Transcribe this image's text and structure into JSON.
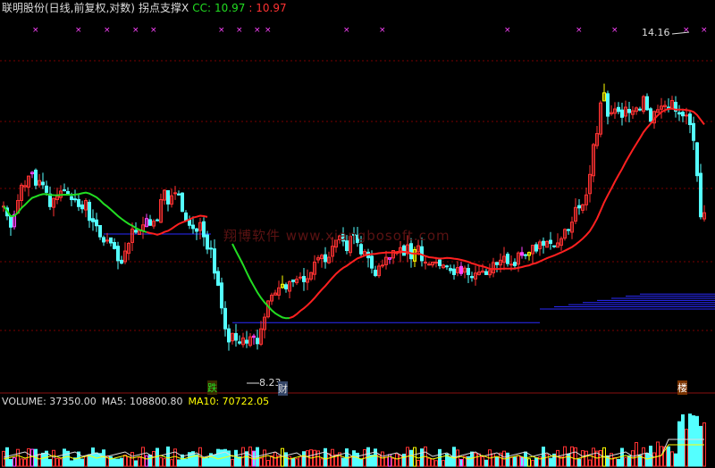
{
  "header": {
    "title": "联明股份(日线,前复权,对数)",
    "indicator": "拐点支撑X",
    "cc_label": "CC:",
    "cc_value": "10.97",
    "cc_value2": ": 10.97"
  },
  "volume_header": {
    "volume": "VOLUME: 37350.00",
    "ma5": "MA5: 108800.80",
    "ma10": "MA10: 70722.05"
  },
  "watermark": "翔博软件 www.xiangbosoft.com",
  "markers": {
    "high_label": "14.16",
    "low_label": "8.23",
    "tag_die": "跌",
    "tag_cai": "财",
    "tag_lou": "楼"
  },
  "colors": {
    "up": "#ff3232",
    "down": "#54ffff",
    "magenta": "#ff44ff",
    "yellow": "#ffff00",
    "ma_green": "#22dd22",
    "ma_red": "#ff2020",
    "support": "#2a2aff",
    "grid": "#7a0000",
    "header_text": "#dcdcdc",
    "cc_label": "#22dd22",
    "cc_value": "#ff3232"
  },
  "chart_data": {
    "type": "candlestick",
    "scale": "log",
    "price_range": [
      7.6,
      16.5
    ],
    "x": [
      1,
      2,
      3,
      4,
      5,
      6,
      7,
      8,
      9,
      10,
      11,
      12,
      13,
      14,
      15,
      16,
      17,
      18,
      19,
      20,
      21,
      22,
      23,
      24,
      25,
      26,
      27,
      28,
      29,
      30,
      31,
      32,
      33,
      34,
      35,
      36,
      37,
      38,
      39,
      40,
      41,
      42,
      43,
      44,
      45,
      46,
      47,
      48,
      49,
      50,
      51,
      52,
      53,
      54,
      55,
      56,
      57,
      58,
      59,
      60,
      61,
      62,
      63,
      64,
      65,
      66,
      67,
      68,
      69,
      70,
      71,
      72,
      73,
      74,
      75,
      76,
      77,
      78,
      79,
      80,
      81,
      82,
      83,
      84,
      85,
      86,
      87,
      88,
      89,
      90,
      91,
      92,
      93,
      94,
      95,
      96,
      97,
      98,
      99,
      100,
      101,
      102,
      103,
      104,
      105,
      106,
      107,
      108,
      109,
      110,
      111,
      112,
      113,
      114,
      115,
      116,
      117,
      118,
      119,
      120,
      121,
      122,
      123,
      124,
      125,
      126,
      127,
      128,
      129,
      130,
      131,
      132,
      133,
      134,
      135,
      136,
      137,
      138,
      139,
      140,
      141,
      142,
      143,
      144,
      145,
      146,
      147,
      148,
      149,
      150,
      151,
      152,
      153,
      154,
      155,
      156,
      157,
      158,
      159,
      160,
      161,
      162,
      163,
      164,
      165,
      166,
      167,
      168,
      169,
      170,
      171,
      172,
      173,
      174,
      175,
      176,
      177,
      178,
      179,
      180,
      181,
      182,
      183,
      184,
      185,
      186,
      187,
      188,
      189,
      190,
      191,
      192,
      193,
      194,
      195,
      196,
      197
    ],
    "close": [
      11.12,
      10.9,
      10.65,
      10.93,
      11.25,
      11.61,
      11.6,
      11.83,
      11.92,
      11.61,
      11.72,
      11.62,
      11.44,
      11.11,
      11.3,
      11.35,
      11.47,
      11.49,
      11.39,
      11.27,
      11.28,
      11.11,
      11.06,
      11.25,
      10.8,
      10.77,
      10.68,
      10.44,
      10.33,
      10.37,
      10.31,
      10.19,
      9.94,
      9.89,
      10.14,
      10.3,
      10.61,
      10.54,
      10.57,
      10.7,
      10.84,
      10.69,
      10.78,
      10.81,
      11.27,
      11.49,
      11.17,
      11.36,
      11.43,
      11.38,
      11.0,
      10.8,
      10.69,
      10.62,
      10.56,
      10.75,
      10.44,
      10.18,
      10.18,
      9.69,
      9.45,
      9.02,
      8.64,
      8.41,
      8.56,
      8.44,
      8.39,
      8.48,
      8.39,
      8.5,
      8.49,
      8.38,
      8.64,
      8.85,
      9.15,
      9.26,
      9.3,
      9.4,
      9.47,
      9.38,
      9.52,
      9.52,
      9.57,
      9.61,
      9.52,
      9.58,
      9.7,
      9.91,
      10.0,
      10.05,
      9.92,
      10.01,
      10.24,
      10.37,
      10.46,
      10.35,
      10.15,
      10.45,
      10.48,
      10.32,
      10.08,
      10.13,
      10.0,
      9.79,
      9.64,
      9.83,
      9.85,
      10.01,
      10.0,
      10.15,
      10.11,
      10.21,
      10.05,
      10.27,
      9.98,
      10.17,
      10.25,
      9.94,
      9.91,
      9.87,
      9.91,
      9.91,
      9.84,
      9.85,
      9.82,
      9.74,
      9.66,
      9.8,
      9.68,
      9.79,
      9.66,
      9.6,
      9.69,
      9.71,
      9.73,
      9.66,
      9.74,
      9.9,
      9.86,
      9.95,
      10.03,
      9.88,
      9.87,
      9.84,
      10.1,
      10.05,
      10.06,
      10.11,
      10.26,
      10.14,
      10.33,
      10.26,
      10.34,
      10.3,
      10.24,
      10.31,
      10.4,
      10.6,
      10.59,
      10.76,
      11.09,
      11.08,
      11.15,
      11.38,
      11.87,
      12.62,
      12.91,
      13.75,
      14.04,
      13.38,
      13.48,
      13.58,
      13.51,
      13.35,
      13.63,
      13.48,
      13.53,
      13.61,
      13.56,
      13.93,
      13.56,
      13.24,
      13.51,
      13.56,
      13.66,
      13.68,
      13.63,
      13.82,
      13.52,
      13.44,
      13.39,
      13.41,
      13.15,
      12.73,
      11.84,
      10.88,
      10.97
    ],
    "high_label_value": 14.16,
    "low_label_value": 8.23,
    "volume_ma5": 108800.8,
    "volume_ma10": 70722.05,
    "volume_last": 37350.0
  }
}
